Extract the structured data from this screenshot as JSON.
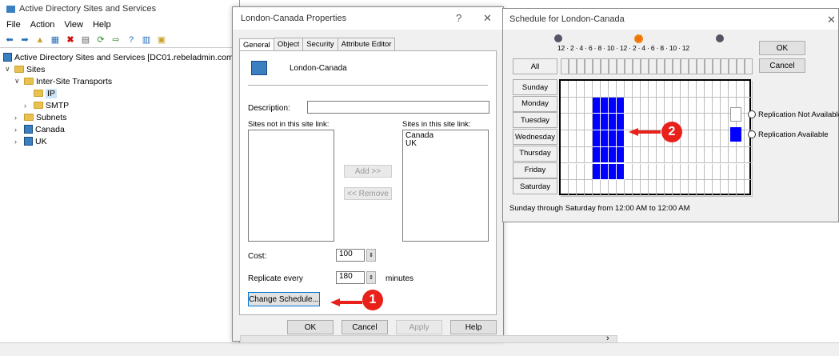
{
  "mmc": {
    "title": "Active Directory Sites and Services",
    "menu": [
      "File",
      "Action",
      "View",
      "Help"
    ],
    "tree": {
      "root": "Active Directory Sites and Services [DC01.rebeladmin.com]",
      "sites": "Sites",
      "inter_site": "Inter-Site Transports",
      "ip": "IP",
      "smtp": "SMTP",
      "subnets": "Subnets",
      "canada": "Canada",
      "uk": "UK"
    }
  },
  "props": {
    "title": "London-Canada Properties",
    "help_glyph": "?",
    "close_glyph": "✕",
    "tabs": [
      "General",
      "Object",
      "Security",
      "Attribute Editor"
    ],
    "name": "London-Canada",
    "description_label": "Description:",
    "description_value": "",
    "not_in_label": "Sites not in this site link:",
    "in_label": "Sites in this site link:",
    "sites_in": [
      "Canada",
      "UK"
    ],
    "add": "Add >>",
    "remove": "<< Remove",
    "cost_label": "Cost:",
    "cost_value": "100",
    "replicate_label": "Replicate every",
    "replicate_value": "180",
    "minutes": "minutes",
    "change_schedule": "Change Schedule...",
    "ok": "OK",
    "cancel": "Cancel",
    "apply": "Apply",
    "help": "Help"
  },
  "sched": {
    "title": "Schedule for London-Canada",
    "close_glyph": "✕",
    "hours_label": "12 · 2 · 4 · 6 · 8 · 10 · 12 · 2 · 4 · 6 · 8 · 10 · 12",
    "all": "All",
    "days": [
      "Sunday",
      "Monday",
      "Tuesday",
      "Wednesday",
      "Thursday",
      "Friday",
      "Saturday"
    ],
    "ok": "OK",
    "cancel": "Cancel",
    "legend_off": "Replication Not Available",
    "legend_on": "Replication Available",
    "summary": "Sunday through Saturday from 12:00 AM to 12:00 AM",
    "on_days": [
      1,
      2,
      3,
      4,
      5
    ],
    "on_hours": [
      4,
      5,
      6,
      7
    ],
    "colors": {
      "available": "#0000ff",
      "callout": "#e8211a"
    }
  },
  "callouts": [
    "1",
    "2"
  ]
}
